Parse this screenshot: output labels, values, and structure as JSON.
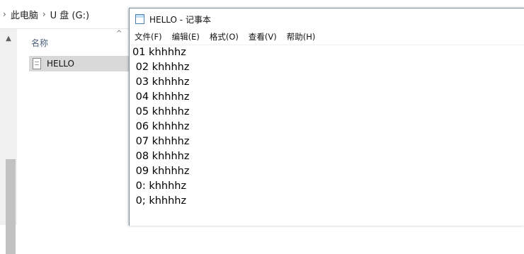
{
  "explorer": {
    "breadcrumb": [
      "此电脑",
      "U 盘 (G:)"
    ],
    "column_header": "名称",
    "files": [
      {
        "name": "HELLO",
        "icon": "text-file-icon",
        "selected": true
      }
    ]
  },
  "notepad": {
    "title": "HELLO - 记事本",
    "menu": [
      "文件(F)",
      "编辑(E)",
      "格式(O)",
      "查看(V)",
      "帮助(H)"
    ],
    "lines": [
      "01 khhhhz",
      " 02 khhhhz",
      " 03 khhhhz",
      " 04 khhhhz",
      " 05 khhhhz",
      " 06 khhhhz",
      " 07 khhhhz",
      " 08 khhhhz",
      " 09 khhhhz",
      " 0: khhhhz",
      " 0; khhhhz"
    ]
  }
}
